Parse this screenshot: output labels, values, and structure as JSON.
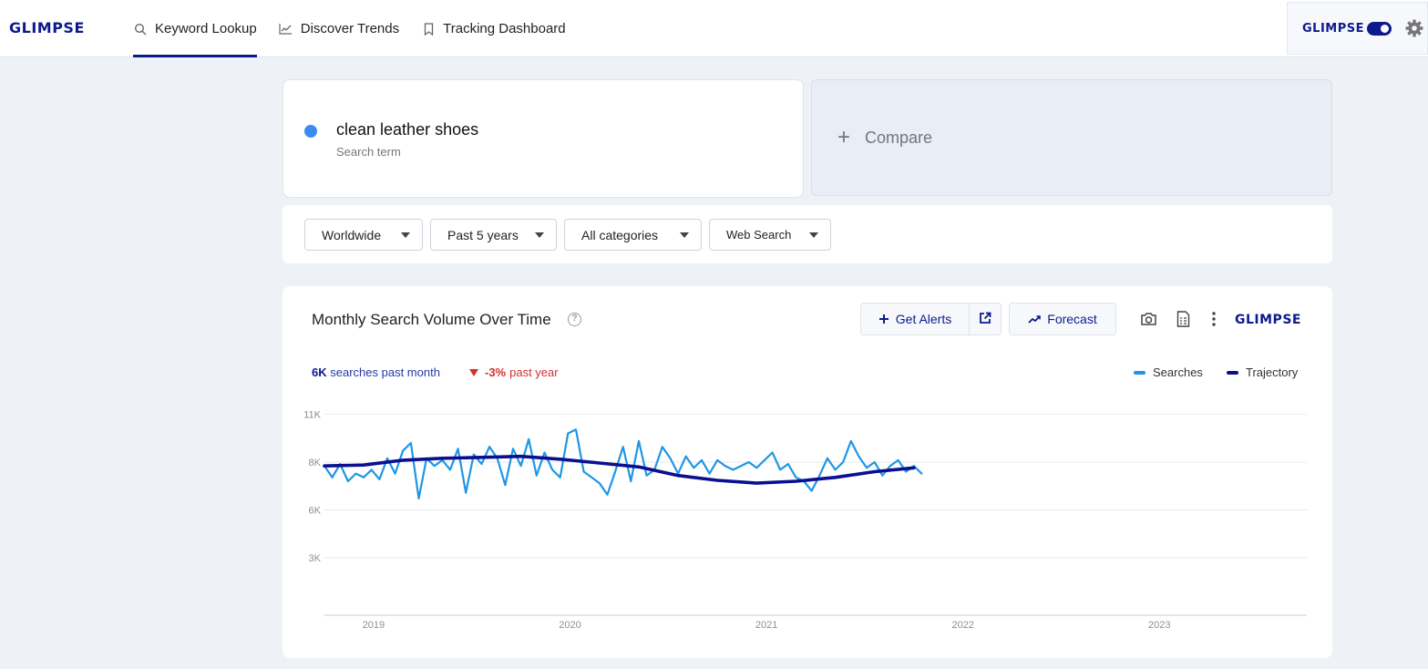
{
  "header": {
    "logo": "GLIMPSE",
    "tabs": [
      {
        "label": "Keyword Lookup",
        "icon": "search-icon",
        "active": true
      },
      {
        "label": "Discover Trends",
        "icon": "trend-icon",
        "active": false
      },
      {
        "label": "Tracking Dashboard",
        "icon": "bookmark-icon",
        "active": false
      }
    ],
    "brand_logo": "GLIMPSE",
    "toggle_on": true
  },
  "search": {
    "term": "clean leather shoes",
    "subtitle": "Search term",
    "dot_color": "#3b8bf2",
    "compare_label": "Compare"
  },
  "filters": {
    "region": "Worldwide",
    "period": "Past 5 years",
    "category": "All categories",
    "source": "Web Search"
  },
  "chart_panel": {
    "title": "Monthly Search Volume Over Time",
    "get_alerts": "Get Alerts",
    "forecast": "Forecast",
    "logo": "GLIMPSE",
    "stat_volume": "6K",
    "stat_volume_text": "searches past month",
    "stat_change": "-3%",
    "stat_change_text": "past year",
    "legend_searches": "Searches",
    "legend_trajectory": "Trajectory"
  },
  "colors": {
    "brand": "#0d1a8c",
    "searches_line": "#1e96e6",
    "trajectory_line": "#0a0f8f",
    "negative": "#d3302f"
  },
  "chart_data": {
    "type": "line",
    "title": "Monthly Search Volume Over Time",
    "xlabel": "",
    "ylabel": "",
    "x_ticks": [
      "2019",
      "2020",
      "2021",
      "2022",
      "2023"
    ],
    "y_ticks": [
      "3K",
      "6K",
      "8K",
      "11K"
    ],
    "y_tick_values": [
      3000,
      5500,
      8000,
      10500
    ],
    "ylim": [
      0,
      11000
    ],
    "x_range": [
      2018.75,
      2023.75
    ],
    "grid": true,
    "legend_position": "top-right",
    "series": [
      {
        "name": "Searches",
        "granularity": "weekly",
        "points": [
          [
            2018.75,
            7800
          ],
          [
            2018.79,
            7200
          ],
          [
            2018.83,
            7900
          ],
          [
            2018.87,
            7000
          ],
          [
            2018.91,
            7400
          ],
          [
            2018.95,
            7200
          ],
          [
            2018.99,
            7600
          ],
          [
            2019.03,
            7100
          ],
          [
            2019.07,
            8200
          ],
          [
            2019.11,
            7400
          ],
          [
            2019.15,
            8600
          ],
          [
            2019.19,
            9000
          ],
          [
            2019.23,
            6100
          ],
          [
            2019.27,
            8200
          ],
          [
            2019.31,
            7800
          ],
          [
            2019.35,
            8100
          ],
          [
            2019.39,
            7600
          ],
          [
            2019.43,
            8700
          ],
          [
            2019.47,
            6400
          ],
          [
            2019.51,
            8400
          ],
          [
            2019.55,
            7900
          ],
          [
            2019.59,
            8800
          ],
          [
            2019.63,
            8200
          ],
          [
            2019.67,
            6800
          ],
          [
            2019.71,
            8700
          ],
          [
            2019.75,
            7800
          ],
          [
            2019.79,
            9200
          ],
          [
            2019.83,
            7300
          ],
          [
            2019.87,
            8500
          ],
          [
            2019.91,
            7600
          ],
          [
            2019.95,
            7200
          ],
          [
            2019.99,
            9500
          ],
          [
            2020.03,
            9700
          ],
          [
            2020.07,
            7500
          ],
          [
            2020.11,
            7200
          ],
          [
            2020.15,
            6900
          ],
          [
            2020.19,
            6300
          ],
          [
            2020.23,
            7500
          ],
          [
            2020.27,
            8800
          ],
          [
            2020.31,
            7000
          ],
          [
            2020.35,
            9100
          ],
          [
            2020.39,
            7300
          ],
          [
            2020.43,
            7600
          ],
          [
            2020.47,
            8800
          ],
          [
            2020.51,
            8200
          ],
          [
            2020.55,
            7400
          ],
          [
            2020.59,
            8300
          ],
          [
            2020.63,
            7700
          ],
          [
            2020.67,
            8100
          ],
          [
            2020.71,
            7400
          ],
          [
            2020.75,
            8100
          ],
          [
            2020.79,
            7800
          ],
          [
            2020.83,
            7600
          ],
          [
            2020.87,
            7800
          ],
          [
            2020.91,
            8000
          ],
          [
            2020.95,
            7700
          ],
          [
            2020.99,
            8100
          ],
          [
            2021.03,
            8500
          ],
          [
            2021.07,
            7600
          ],
          [
            2021.11,
            7900
          ],
          [
            2021.15,
            7200
          ],
          [
            2021.19,
            7000
          ],
          [
            2021.23,
            6500
          ],
          [
            2021.27,
            7300
          ],
          [
            2021.31,
            8200
          ],
          [
            2021.35,
            7600
          ],
          [
            2021.39,
            8000
          ],
          [
            2021.43,
            9100
          ],
          [
            2021.47,
            8300
          ],
          [
            2021.51,
            7700
          ],
          [
            2021.55,
            8000
          ],
          [
            2021.59,
            7300
          ],
          [
            2021.63,
            7800
          ],
          [
            2021.67,
            8100
          ],
          [
            2021.71,
            7500
          ],
          [
            2021.75,
            7800
          ],
          [
            2021.79,
            7400
          ]
        ]
      },
      {
        "name": "Trajectory",
        "granularity": "smoothed",
        "points": [
          [
            2018.75,
            7800
          ],
          [
            2018.95,
            7850
          ],
          [
            2019.15,
            8100
          ],
          [
            2019.35,
            8200
          ],
          [
            2019.55,
            8250
          ],
          [
            2019.75,
            8300
          ],
          [
            2019.95,
            8150
          ],
          [
            2020.15,
            7950
          ],
          [
            2020.35,
            7750
          ],
          [
            2020.55,
            7300
          ],
          [
            2020.75,
            7050
          ],
          [
            2020.95,
            6900
          ],
          [
            2021.15,
            7000
          ],
          [
            2021.35,
            7200
          ],
          [
            2021.55,
            7500
          ],
          [
            2021.75,
            7700
          ]
        ]
      }
    ]
  }
}
